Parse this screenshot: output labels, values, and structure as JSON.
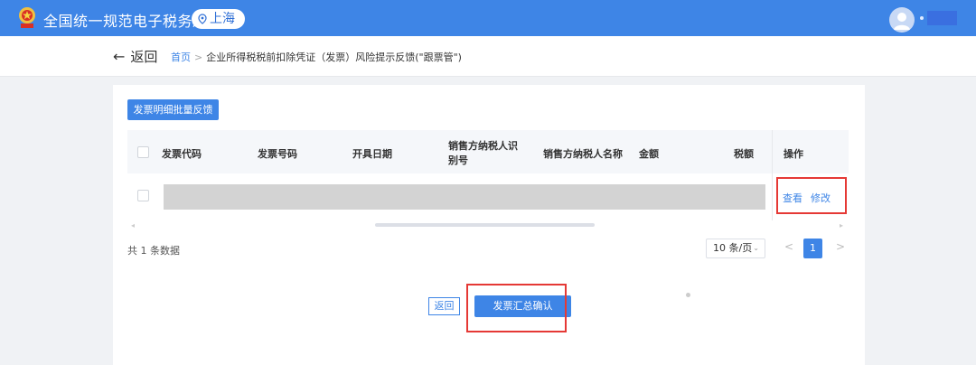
{
  "header": {
    "app_title": "全国统一规范电子税务局",
    "region": "上海",
    "icons": {
      "logo": "emblem-icon",
      "location": "location-pin-icon",
      "avatar": "user-avatar-icon"
    }
  },
  "subheader": {
    "back_label": "返回",
    "breadcrumb": {
      "home": "首页",
      "separator": ">",
      "current": "企业所得税税前扣除凭证（发票）风险提示反馈(\"跟票管\")"
    }
  },
  "toolbar": {
    "batch_feedback_label": "发票明细批量反馈"
  },
  "table": {
    "columns": [
      {
        "label": "发票代码"
      },
      {
        "label": "发票号码"
      },
      {
        "label": "开具日期"
      },
      {
        "label": "销售方纳税人识别号"
      },
      {
        "label": "销售方纳税人名称"
      },
      {
        "label": "金额"
      },
      {
        "label": "税额"
      },
      {
        "label": "操作"
      }
    ],
    "row_actions": {
      "view": "查看",
      "edit": "修改"
    }
  },
  "pagination": {
    "total_text": "共 1 条数据",
    "page_size": "10 条/页",
    "current_page": "1",
    "prev": "<",
    "next": ">"
  },
  "footer": {
    "back_label": "返回",
    "confirm_label": "发票汇总确认"
  },
  "colors": {
    "accent": "#3e85e6",
    "highlight": "#e53935",
    "masked_row": "#d3d3d3"
  }
}
